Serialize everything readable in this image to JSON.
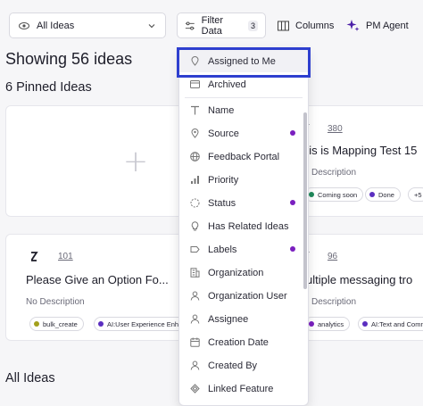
{
  "toolbar": {
    "view_label": "All Ideas",
    "filter_label": "Filter Data",
    "filter_count": "3",
    "columns_label": "Columns",
    "agent_label": "PM Agent"
  },
  "headings": {
    "showing": "Showing 56 ideas",
    "pinned": "6 Pinned Ideas",
    "all": "All Ideas"
  },
  "cards": {
    "right_top": {
      "number": "380",
      "title": "his is Mapping Test 15",
      "description": "Description",
      "tags": [
        {
          "label": "Coming soon",
          "color": "#1f8a5b"
        },
        {
          "label": "Done",
          "color": "#5b2ec0"
        },
        {
          "label": "+5"
        }
      ]
    },
    "left_bottom": {
      "number": "101",
      "title": "Please Give an Option Fo...",
      "description": "No Description",
      "tags": [
        {
          "label": "bulk_create",
          "color": "#a3a01c"
        },
        {
          "label": "AI:User Experience Enha",
          "color": "#5b2ec0"
        }
      ]
    },
    "right_bottom": {
      "number": "96",
      "title": "ultiple messaging tro",
      "description": "Description",
      "tags": [
        {
          "label": "analytics",
          "color": "#7a1fbf"
        },
        {
          "label": "AI:Text and Comm",
          "color": "#5b2ec0"
        }
      ]
    }
  },
  "filter_menu": {
    "items": [
      {
        "label": "Assigned to Me",
        "icon": "location-pin-icon"
      },
      {
        "label": "Archived",
        "icon": "archive-icon"
      },
      {
        "label": "Name",
        "icon": "text-icon"
      },
      {
        "label": "Source",
        "icon": "location-pin-icon",
        "active": true
      },
      {
        "label": "Feedback Portal",
        "icon": "globe-icon"
      },
      {
        "label": "Priority",
        "icon": "bar-chart-icon"
      },
      {
        "label": "Status",
        "icon": "status-icon",
        "active": true
      },
      {
        "label": "Has Related Ideas",
        "icon": "bulb-icon"
      },
      {
        "label": "Labels",
        "icon": "label-icon",
        "active": true
      },
      {
        "label": "Organization",
        "icon": "building-icon"
      },
      {
        "label": "Organization User",
        "icon": "user-icon"
      },
      {
        "label": "Assignee",
        "icon": "user-icon"
      },
      {
        "label": "Creation Date",
        "icon": "calendar-icon"
      },
      {
        "label": "Created By",
        "icon": "user-icon"
      },
      {
        "label": "Linked Feature",
        "icon": "link-icon"
      }
    ],
    "active_dot_color": "#7a1fbf"
  },
  "colors": {
    "highlight": "#2e3fcf",
    "accent": "#7a1fbf"
  }
}
